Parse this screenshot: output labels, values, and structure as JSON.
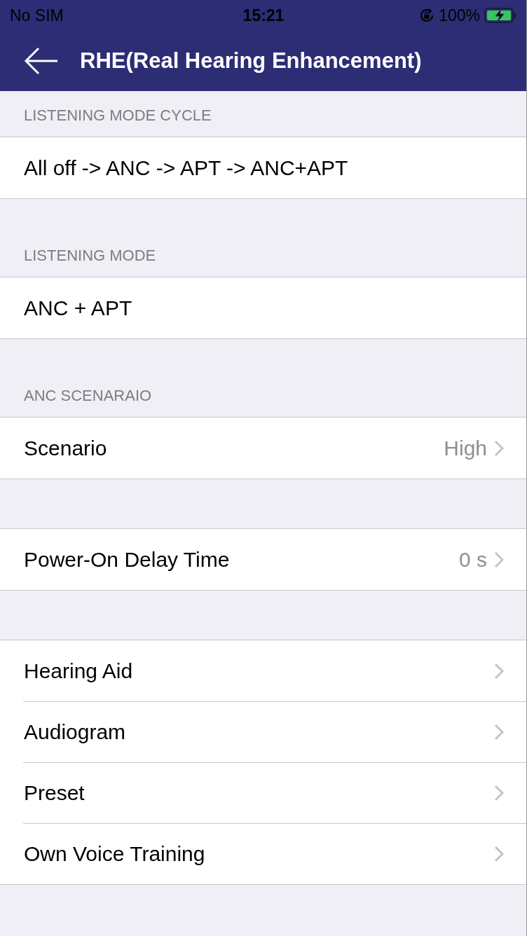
{
  "status_bar": {
    "carrier": "No SIM",
    "time": "15:21",
    "battery": "100%",
    "orientation_lock": true,
    "charging": true
  },
  "nav_bar": {
    "title": "RHE(Real Hearing Enhancement)"
  },
  "sections": [
    {
      "header": "LISTENING MODE CYCLE",
      "rows": [
        {
          "kind": "plain",
          "label": "All off -> ANC -> APT -> ANC+APT"
        }
      ]
    },
    {
      "header": "LISTENING MODE",
      "rows": [
        {
          "kind": "plain",
          "label": "ANC + APT"
        }
      ]
    },
    {
      "header": "ANC SCENARAIO",
      "rows": [
        {
          "kind": "disclosure",
          "label": "Scenario",
          "value": "High"
        }
      ]
    },
    {
      "rows": [
        {
          "kind": "disclosure",
          "label": "Power-On Delay Time",
          "value": "0 s"
        }
      ]
    },
    {
      "rows": [
        {
          "kind": "disclosure",
          "label": "Hearing Aid"
        },
        {
          "kind": "disclosure",
          "label": "Audiogram"
        },
        {
          "kind": "disclosure",
          "label": "Preset"
        },
        {
          "kind": "disclosure",
          "label": "Own Voice Training"
        }
      ]
    }
  ]
}
